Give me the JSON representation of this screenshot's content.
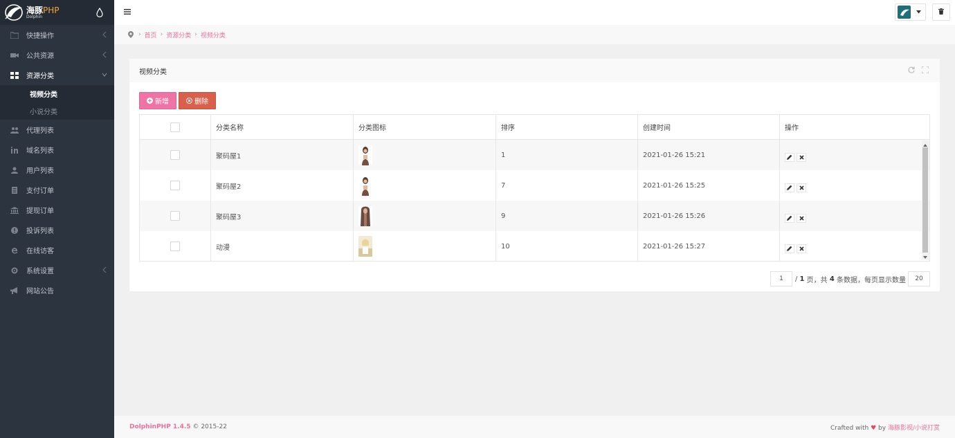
{
  "app": {
    "logo_cn": "海豚",
    "logo_php": "PHP",
    "logo_en": "Dolphin"
  },
  "sidebar": {
    "items": [
      {
        "label": "快捷操作",
        "icon": "folder-icon",
        "has_chevron": true
      },
      {
        "label": "公共资源",
        "icon": "video-camera-icon",
        "has_chevron": true
      },
      {
        "label": "资源分类",
        "icon": "grid-icon",
        "has_chevron": true,
        "open": true
      },
      {
        "label": "代理列表",
        "icon": "users-icon"
      },
      {
        "label": "域名列表",
        "icon": "linkedin-icon"
      },
      {
        "label": "用户列表",
        "icon": "user-icon"
      },
      {
        "label": "支付订单",
        "icon": "document-icon"
      },
      {
        "label": "提现订单",
        "icon": "bank-icon"
      },
      {
        "label": "投诉列表",
        "icon": "alert-circle-icon"
      },
      {
        "label": "在线访客",
        "icon": "ie-icon"
      },
      {
        "label": "系统设置",
        "icon": "gear-icon",
        "has_chevron": true
      },
      {
        "label": "网站公告",
        "icon": "bullhorn-icon"
      }
    ],
    "subitems": [
      {
        "label": "视频分类",
        "active": true
      },
      {
        "label": "小说分类"
      }
    ]
  },
  "breadcrumb": [
    "首页",
    "资源分类",
    "视频分类"
  ],
  "panel": {
    "title": "视频分类",
    "add_label": "新增",
    "delete_label": "删除"
  },
  "table": {
    "headers": [
      "分类名称",
      "分类图标",
      "排序",
      "创建时间",
      "操作"
    ],
    "rows": [
      {
        "name": "聚码屋1",
        "sort": "1",
        "created": "2021-01-26 15:21"
      },
      {
        "name": "聚码屋2",
        "sort": "7",
        "created": "2021-01-26 15:25"
      },
      {
        "name": "聚码屋3",
        "sort": "9",
        "created": "2021-01-26 15:26"
      },
      {
        "name": "动漫",
        "sort": "10",
        "created": "2021-01-26 15:27"
      }
    ]
  },
  "pager": {
    "current_page": "1",
    "total_pages": "1",
    "page_suffix": "页，共",
    "total": "4",
    "total_suffix": "条数据，每页显示数量",
    "per_page": "20"
  },
  "footer": {
    "brand": "DolphinPHP 1.4.5",
    "copyright": "© 2015-22",
    "crafted": "Crafted with",
    "heart": "♥",
    "by": "by",
    "link": "海豚影视/小说打赏"
  },
  "colors": {
    "sidebar_bg": "#2c343f",
    "accent_pink": "#f073a6",
    "danger": "#d9604b",
    "link": "#e9729b"
  }
}
